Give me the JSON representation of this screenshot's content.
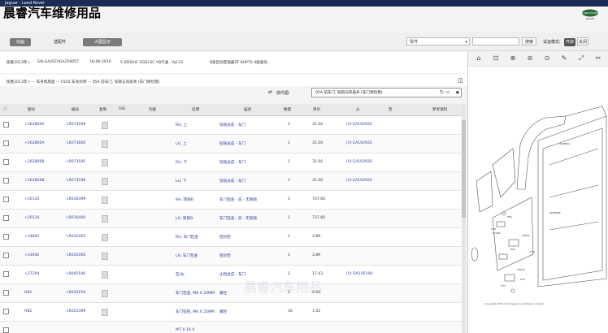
{
  "window": {
    "title": "Jaguar - Land Rover"
  },
  "watermark_top": "晨睿汽车维修用品",
  "toolbar": {
    "home_label": "动画",
    "link_label": "选配件",
    "dark_btn_label": "大图显示",
    "select_value": "零件",
    "search_label": "搜索",
    "mode_label": "试运模式:",
    "toggle_on": "开启",
    "toggle_off": "关闭"
  },
  "info": {
    "vehicle": "揽胜2013年+",
    "vin": "SALGA2EF0GA256057",
    "date": "18-09-2016",
    "engine": "5.0升DHC SGDI SC V8汽油 - AJ133",
    "trans": "8速自动变速器ZF 8HP70 4驱驱动"
  },
  "breadcrumb": "揽胜2013年+ ··· 车身和底盘 ··· 0103 车身封闭 ··· 05A 前车门, 铰链与风扇条 (车门保险锁)",
  "group": {
    "label": "部件图:",
    "value": "05A 前车门, 铰链与风扇条 (车门保险锁)"
  },
  "table": {
    "headers": [
      "图号",
      "编号",
      "复制",
      "OSI",
      "功能",
      "说明",
      "描述",
      "数量",
      "单价",
      "从",
      "至",
      "参考资料"
    ],
    "rows": [
      {
        "ref": "+262800A",
        "part": "LR073599",
        "desc": "RH, 上",
        "name": "铰链总成 - 车门",
        "qty": "1",
        "price": "31.00",
        "from": "(V) EA192935",
        "to": ""
      },
      {
        "ref": "+262800A",
        "part": "LR073600",
        "desc": "LH, 上",
        "name": "铰链总成 - 车门",
        "qty": "1",
        "price": "31.00",
        "from": "(V) EA192935",
        "to": ""
      },
      {
        "ref": "+262800B",
        "part": "LR073595",
        "desc": "RH, 下",
        "name": "铰链总成 - 车门",
        "qty": "1",
        "price": "31.00",
        "from": "(V) EA192935",
        "to": ""
      },
      {
        "ref": "+262800B",
        "part": "LR073596",
        "desc": "LH, 下",
        "name": "铰链总成 - 车门",
        "qty": "1",
        "price": "31.00",
        "from": "(V) EA192935",
        "to": ""
      },
      {
        "ref": "+20124",
        "part": "LR036399",
        "desc": "RH, 新部B",
        "name": "车门检查 - 前 - 无限锁",
        "qty": "1",
        "price": "737.60",
        "from": "",
        "to": ""
      },
      {
        "ref": "+20124",
        "part": "LR036400",
        "desc": "LH, 新部B",
        "name": "车门检查 - 前 - 无限锁",
        "qty": "1",
        "price": "737.60",
        "from": "",
        "to": ""
      },
      {
        "ref": "+24692",
        "part": "LR030265",
        "desc": "RH, 车门检查",
        "name": "密封垫",
        "qty": "1",
        "price": "3.89",
        "from": "",
        "to": ""
      },
      {
        "ref": "+24692",
        "part": "LR030266",
        "desc": "LH, 车门检查",
        "name": "密封垫",
        "qty": "1",
        "price": "3.89",
        "from": "",
        "to": ""
      },
      {
        "ref": "+27204",
        "part": "LR045540",
        "desc": "在/左",
        "name": "止档总成 - 车门",
        "qty": "2",
        "price": "17.43",
        "from": "(V) DA105100",
        "to": ""
      },
      {
        "ref": "H81",
        "part": "LR032019",
        "desc": "车门检查, M8 X 20MM",
        "name": "螺栓",
        "qty": "2",
        "price": "0.62",
        "from": "",
        "to": ""
      },
      {
        "ref": "H82",
        "part": "LR025399",
        "desc": "车门铰链, M6 X 25MM",
        "name": "螺栓",
        "qty": "16",
        "price": "1.02",
        "from": "",
        "to": ""
      },
      {
        "ref": "",
        "part": "",
        "desc": "M7 X 14.4",
        "name": "",
        "qty": "",
        "price": "",
        "from": "",
        "to": ""
      }
    ]
  },
  "diagram": {
    "caption": "Copyright 2016-2017 Jaguar Land Rover Limited",
    "labels": [
      "H81",
      "H82",
      "27204",
      "24692",
      "20124",
      "262800A",
      "262800B",
      "H76",
      "H71",
      "H72",
      "H73"
    ]
  },
  "bottom_watermark": "晨睿汽车用品",
  "colors": {
    "titlebar": "#1c2b55",
    "link_blue": "#2e3d9c"
  }
}
